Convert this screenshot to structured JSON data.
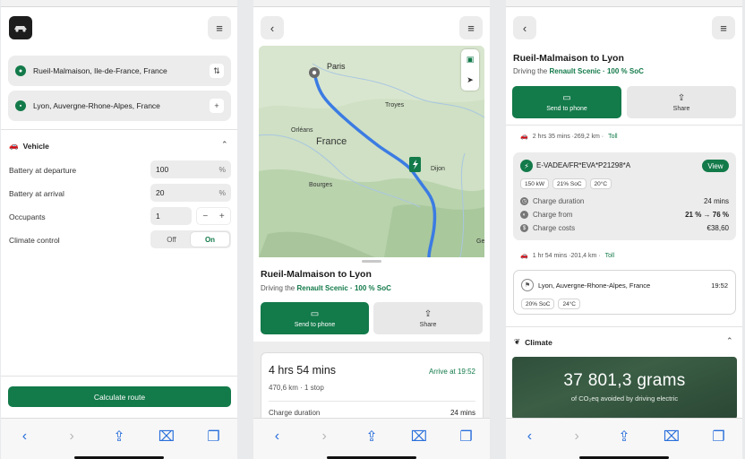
{
  "colors": {
    "accent": "#137a4a",
    "link": "#2a6fdb"
  },
  "screen1": {
    "origin": "Rueil-Malmaison, Ile-de-France, France",
    "destination": "Lyon, Auvergne-Rhone-Alpes, France",
    "vehicle_section": "Vehicle",
    "rows": {
      "battery_departure": {
        "label": "Battery at departure",
        "value": "100",
        "unit": "%"
      },
      "battery_arrival": {
        "label": "Battery at arrival",
        "value": "20",
        "unit": "%"
      },
      "occupants": {
        "label": "Occupants",
        "value": "1",
        "minus": "−",
        "plus": "+"
      },
      "climate": {
        "label": "Climate control",
        "off": "Off",
        "on": "On",
        "selected": "On"
      }
    },
    "calculate": "Calculate route"
  },
  "screen2": {
    "map_labels": {
      "paris": "Paris",
      "troyes": "Troyes",
      "orleans": "Orléans",
      "france": "France",
      "dijon": "Dijon",
      "bourges": "Bourges",
      "ge": "Ge"
    },
    "title": "Rueil-Malmaison to Lyon",
    "sub_prefix": "Driving the",
    "sub_car": "Renault Scenic · 100 % SoC",
    "send_to_phone": "Send to phone",
    "share": "Share",
    "duration": "4 hrs 54 mins",
    "arrive": "Arrive at 19:52",
    "distance_stops": "470,6 km · 1 stop",
    "charge_duration_label": "Charge duration",
    "charge_duration_value": "24 mins"
  },
  "screen3": {
    "title": "Rueil-Malmaison to Lyon",
    "sub_prefix": "Driving the",
    "sub_car": "Renault Scenic · 100 % SoC",
    "send_to_phone": "Send to phone",
    "share": "Share",
    "leg1_text": "2 hrs 35 mins ·269,2 km ·",
    "leg1_toll": "Toll",
    "station_name": "E-VADEA/FR*EVA*P21298*A",
    "view": "View",
    "station_chips": [
      "150 kW",
      "21% SoC",
      "20°C"
    ],
    "charge_duration_label": "Charge duration",
    "charge_duration_value": "24 mins",
    "charge_from_label": "Charge from",
    "charge_from_value": "21 % → 76 %",
    "charge_costs_label": "Charge costs",
    "charge_costs_value": "€38,60",
    "leg2_text": "1 hr 54 mins ·201,4 km ·",
    "leg2_toll": "Toll",
    "dest_name": "Lyon, Auvergne-Rhone-Alpes, France",
    "dest_time": "19:52",
    "dest_chips": [
      "20% SoC",
      "24°C"
    ],
    "climate_section": "Climate",
    "co2_big": "37 801,3 grams",
    "co2_small": "of CO₂eq avoided by driving electric"
  }
}
